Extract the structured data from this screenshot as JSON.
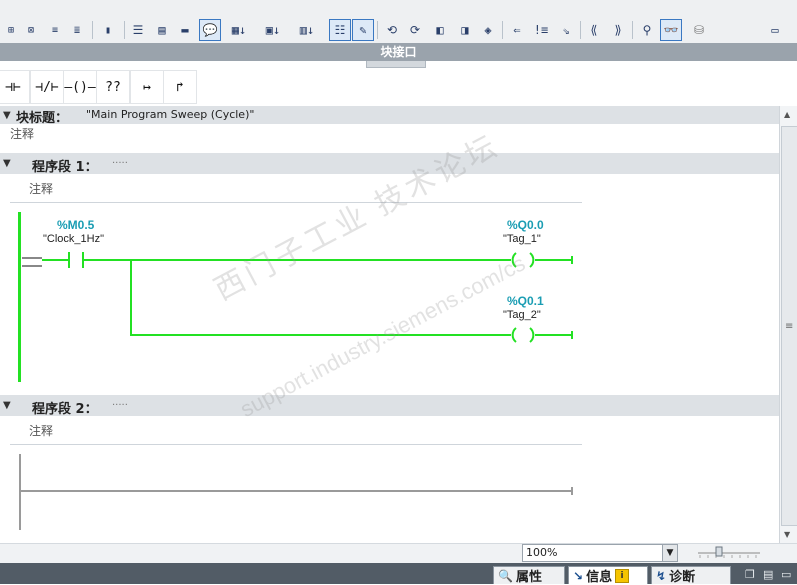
{
  "toolbar": {
    "icons": [
      "insert-network-icon",
      "delete-network-icon",
      "insert-row-icon",
      "delete-row-icon",
      "open-block-icon",
      "show-absolute-icon",
      "show-symbolic-icon",
      "show-symbol-info-icon",
      "comments-icon",
      "show-favorites-icon",
      "insert-box-icon",
      "insert-contact-icon",
      "insert-coil-icon",
      "toggle-view-icon",
      "recent-instruction-icon",
      "go-to-error-icon",
      "previous-error-icon",
      "next-error-icon",
      "monitor-icon",
      "monitor-off-icon",
      "go-to-previous-icon",
      "go-to-next-icon",
      "jump-icon",
      "single-step-icon",
      "expand-icon",
      "collapse-icon",
      "compare-icon",
      "glasses-icon",
      "database-icon",
      "window-icon"
    ]
  },
  "interface_bar": {
    "label": "块接口"
  },
  "palette": {
    "items": [
      {
        "name": "no-contact-button",
        "glyph": "⊣⊢"
      },
      {
        "name": "nc-contact-button",
        "glyph": "⊣/⊢"
      },
      {
        "name": "coil-button",
        "glyph": "–()–"
      },
      {
        "name": "empty-box-button",
        "glyph": "??"
      },
      {
        "name": "open-branch-button",
        "glyph": "↦"
      },
      {
        "name": "close-branch-button",
        "glyph": "↱"
      }
    ]
  },
  "block": {
    "title_label": "块标题：",
    "title_value": "\"Main Program Sweep (Cycle)\"",
    "comment": "注释"
  },
  "networks": [
    {
      "label": "程序段 1：",
      "title_placeholder": ".....",
      "comment": "注释",
      "contacts": [
        {
          "address": "%M0.5",
          "tag": "\"Clock_1Hz\""
        }
      ],
      "coils": [
        {
          "address": "%Q0.0",
          "tag": "\"Tag_1\""
        },
        {
          "address": "%Q0.1",
          "tag": "\"Tag_2\""
        }
      ]
    },
    {
      "label": "程序段 2：",
      "title_placeholder": ".....",
      "comment": "注释"
    }
  ],
  "watermark": {
    "cn": "西门子工业 技术论坛",
    "url": "support.industry.siemens.com/cs"
  },
  "status": {
    "zoom": "100%"
  },
  "bottom_tabs": [
    {
      "label": "属性",
      "icon": "properties-icon"
    },
    {
      "label": "信息",
      "icon": "info-icon",
      "selected": true
    },
    {
      "label": "诊断",
      "icon": "diagnostics-icon"
    }
  ],
  "colors": {
    "rung": "#23e123",
    "address": "#1a9db3",
    "band": "#dde1e5"
  }
}
